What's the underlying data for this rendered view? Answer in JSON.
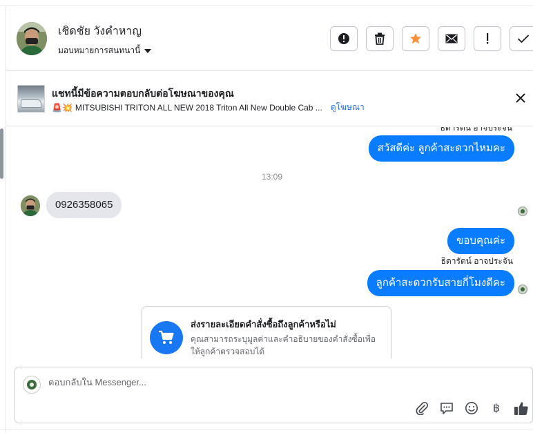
{
  "header": {
    "contact_name": "เชิดชัย วังคำหาญ",
    "assign_label": "มอบหมายการสนทนานี้"
  },
  "actions": [
    {
      "name": "report-spam-button",
      "icon": "exclamation-circle-icon"
    },
    {
      "name": "delete-button",
      "icon": "trash-icon"
    },
    {
      "name": "star-button",
      "icon": "star-icon",
      "color": "#f7923b"
    },
    {
      "name": "mark-unread-button",
      "icon": "envelope-icon"
    },
    {
      "name": "follow-up-button",
      "icon": "exclamation-icon"
    },
    {
      "name": "mark-done-button",
      "icon": "check-icon"
    }
  ],
  "ad": {
    "title": "แชทนี้มีข้อความตอบกลับต่อโฆษณาของคุณ",
    "prefix_icon": "🚨💥",
    "subtitle": "MITSUBISHI TRITON ALL NEW 2018 Triton All New Double Cab ...",
    "link": "ดูโฆษณา"
  },
  "thread": {
    "sender_name_top": "ธิดารัตน์ อาจประจัน",
    "messages": [
      {
        "direction": "out",
        "text": "สวัสดีค่ะ ลูกค้าสะดวกไหมคะ"
      },
      {
        "direction": "in",
        "text": "0926358065"
      },
      {
        "direction": "out",
        "text": "ขอบคุณค่ะ"
      },
      {
        "direction": "out",
        "text": "ลูกค้าสะดวกรับสายกี่โมงดีคะ"
      }
    ],
    "timestamp": "13:09",
    "sender_name": "ธิดารัตน์ อาจประจัน",
    "order_card": {
      "title": "ส่งรายละเอียดคำสั่งซื้อถึงลูกค้าหรือไม่",
      "description": "คุณสามารถระบุมูลค่าและคำอธิบายของคำสั่งซื้อเพื่อให้ลูกค้าตรวจสอบได้",
      "icon": "cart-icon"
    }
  },
  "composer": {
    "placeholder": "ตอบกลับใน Messenger...",
    "tools": [
      "paperclip-icon",
      "saved-reply-icon",
      "emoji-icon",
      "baht-icon",
      "thumbs-up-icon"
    ],
    "baht_symbol": "฿"
  },
  "colors": {
    "accent": "#0a7cff",
    "link": "#216fdb",
    "star": "#f7923b",
    "incoming_bubble": "#e4e6eb"
  }
}
